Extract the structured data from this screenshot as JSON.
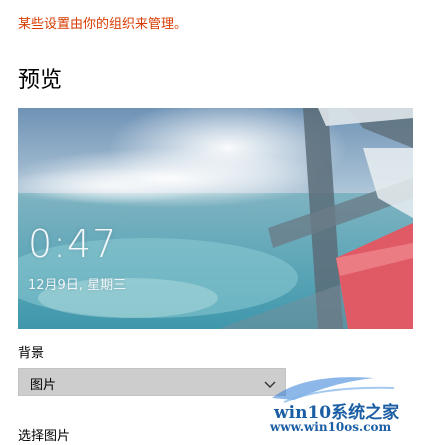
{
  "notice": {
    "managed_by_org": "某些设置由你的组织来管理。"
  },
  "preview": {
    "title": "预览",
    "clock_time": "0:47",
    "date": "12月9日, 星期三"
  },
  "background": {
    "label": "背景",
    "selected": "图片",
    "chevron_icon": "chevron-down-icon"
  },
  "choose_picture": {
    "label": "选择图片"
  },
  "watermark": {
    "brand": "win10系统之家",
    "url": "www.win10os.com"
  },
  "colors": {
    "notice": "#d83b01",
    "dropdown_bg": "#cdcdcd",
    "watermark": "#1b5ea3"
  }
}
